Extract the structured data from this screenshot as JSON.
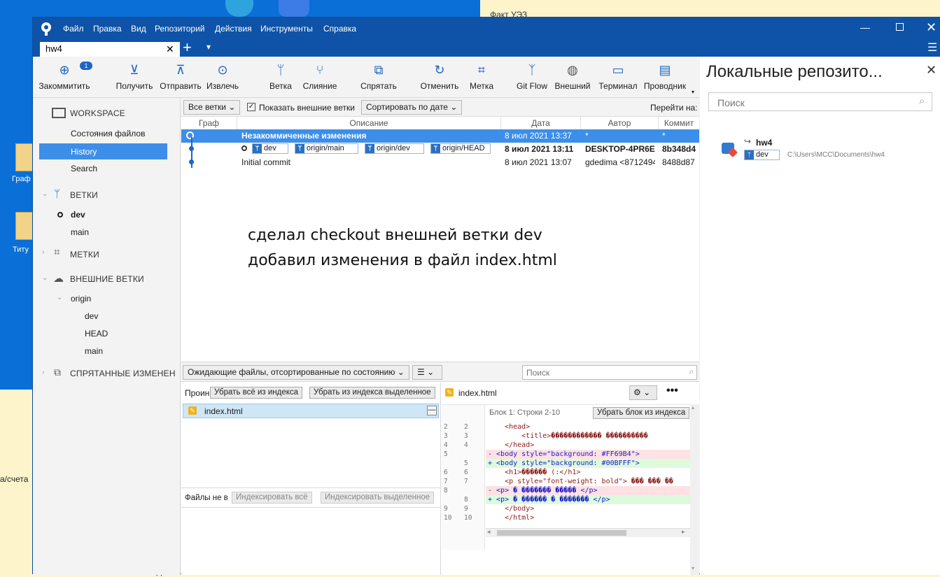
{
  "desktop": {
    "icon1_label": "Граф",
    "icon2_label": "Титу",
    "side_text": "а/счета",
    "bottom_text": "ВКЛАДЫ...",
    "bg_note": "Факт УЭЗ"
  },
  "window": {
    "menu": [
      "Файл",
      "Правка",
      "Вид",
      "Репозиторий",
      "Действия",
      "Инструменты",
      "Справка"
    ],
    "tab_label": "hw4",
    "add_tab": "+",
    "tab_menu": "▾"
  },
  "toolbar": {
    "badge": "1",
    "buttons": [
      "Закоммитить",
      "Получить",
      "Отправить",
      "Извлечь",
      "Ветка",
      "Слияние",
      "Спрятать",
      "Отменить",
      "Метка",
      "Git Flow",
      "Внешний",
      "Терминал",
      "Проводник"
    ]
  },
  "sidebar": {
    "workspace": "WORKSPACE",
    "file_status": "Состояния файлов",
    "history": "History",
    "search": "Search",
    "branches": "ВЕТКИ",
    "branch_dev": "dev",
    "branch_main": "main",
    "tags": "МЕТКИ",
    "remotes": "ВНЕШНИЕ ВЕТКИ",
    "origin": "origin",
    "remote_dev": "dev",
    "remote_head": "HEAD",
    "remote_main": "main",
    "stashes": "СПРЯТАННЫЕ ИЗМЕНЕНИЯ"
  },
  "history": {
    "filter_all": "Все ветки",
    "show_remote": "Показать внешние ветки",
    "sort": "Сортировать по дате",
    "goto": "Перейти на:",
    "columns": [
      "Граф",
      "Описание",
      "Дата",
      "Автор",
      "Коммит"
    ],
    "rows": [
      {
        "desc": "Незакоммиченные изменения",
        "date": "8 июл 2021 13:37",
        "author": "*",
        "commit": "*"
      },
      {
        "desc": "",
        "date": "8 июл 2021 13:11",
        "author": "DESKTOP-4PR6EC",
        "commit": "8b348d4"
      },
      {
        "desc": "Initial commit",
        "date": "8 июл 2021 13:07",
        "author": "gdedima <8712494",
        "commit": "8488d87"
      }
    ],
    "tags": [
      "dev",
      "origin/main",
      "origin/dev",
      "origin/HEAD"
    ]
  },
  "note": {
    "line1": "сделал checkout внешней ветки dev",
    "line2": "добавил изменения в файл index.html"
  },
  "staging": {
    "pending_sort": "Ожидающие файлы, отсортированные по состоянию",
    "list_mode": "☰",
    "search_placeholder": "Поиск",
    "staged_label": "Проин",
    "unstage_all": "Убрать всё из индекса",
    "unstage_selected": "Убрать из индекса выделенное",
    "staged_file": "index.html",
    "unstaged_label": "Файлы не в",
    "stage_all": "Индексировать всё",
    "stage_selected": "Индексировать выделенное"
  },
  "diff": {
    "filename": "index.html",
    "hunk": "Блок 1: Строки 2-10",
    "unstage_hunk": "Убрать блок из индекса",
    "lines": [
      {
        "old": "2",
        "new": "2",
        "type": "ctx",
        "text": "    <head>"
      },
      {
        "old": "3",
        "new": "3",
        "type": "ctx",
        "text": "        <title>������������ ����������"
      },
      {
        "old": "4",
        "new": "4",
        "type": "ctx",
        "text": "    </head>"
      },
      {
        "old": "5",
        "new": "",
        "type": "del",
        "text": "- <body style=\"background: #FF69B4\">"
      },
      {
        "old": "",
        "new": "5",
        "type": "add",
        "text": "+ <body style=\"background: #00BFFF\">"
      },
      {
        "old": "6",
        "new": "6",
        "type": "ctx",
        "text": "    <h1>������ (:</h1>"
      },
      {
        "old": "7",
        "new": "7",
        "type": "ctx",
        "text": "    <p style=\"font-weight: bold\"> ��� ��� ��"
      },
      {
        "old": "8",
        "new": "",
        "type": "del",
        "text": "- <p> � ������� ����� </p>"
      },
      {
        "old": "",
        "new": "8",
        "type": "add",
        "text": "+ <p> � ������ � ������� </p>"
      },
      {
        "old": "9",
        "new": "9",
        "type": "ctx",
        "text": "    </body>"
      },
      {
        "old": "10",
        "new": "10",
        "type": "ctx",
        "text": "    </html>"
      }
    ]
  },
  "repos": {
    "title": "Локальные репозито...",
    "search_placeholder": "Поиск",
    "name": "hw4",
    "branch": "dev",
    "path": "C:\\Users\\MCC\\Documents\\hw4"
  },
  "colors": {
    "accent": "#0e53a7",
    "selection": "#3d8ee8",
    "del_bg": "#ffe1e4",
    "add_bg": "#ddfadd"
  }
}
